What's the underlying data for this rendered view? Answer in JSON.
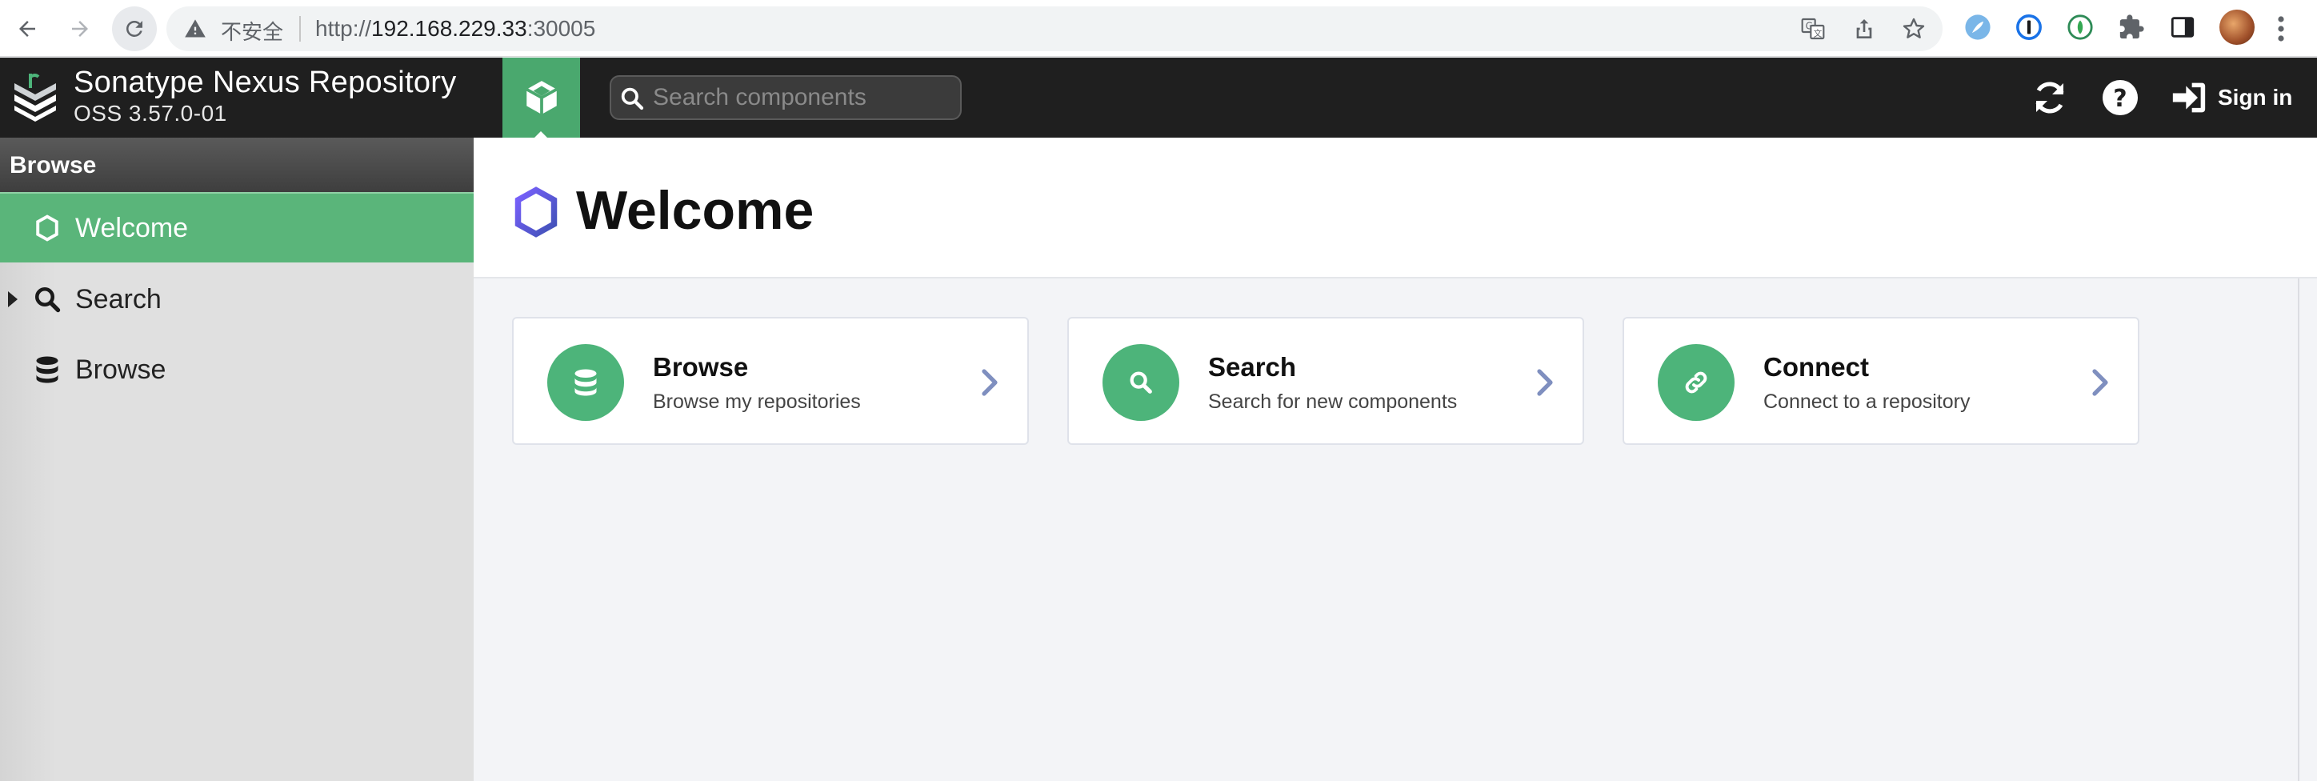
{
  "browser": {
    "insecure_label": "不安全",
    "url_scheme": "http://",
    "url_host": "192.168.229.33",
    "url_port": ":30005"
  },
  "header": {
    "title": "Sonatype Nexus Repository",
    "version": "OSS 3.57.0-01",
    "search_placeholder": "Search components",
    "sign_in": "Sign in"
  },
  "sidebar": {
    "header": "Browse",
    "items": [
      {
        "label": "Welcome",
        "icon": "hexagon-icon",
        "active": true
      },
      {
        "label": "Search",
        "icon": "search-icon",
        "expandable": true
      },
      {
        "label": "Browse",
        "icon": "database-icon"
      }
    ]
  },
  "main": {
    "title": "Welcome",
    "cards": [
      {
        "title": "Browse",
        "subtitle": "Browse my repositories",
        "icon": "database-icon"
      },
      {
        "title": "Search",
        "subtitle": "Search for new components",
        "icon": "search-icon"
      },
      {
        "title": "Connect",
        "subtitle": "Connect to a repository",
        "icon": "link-icon"
      }
    ]
  },
  "colors": {
    "accent_green": "#4db47a",
    "header_bg": "#1f1f1f",
    "hexagon_purple": "#5b5bd6"
  }
}
